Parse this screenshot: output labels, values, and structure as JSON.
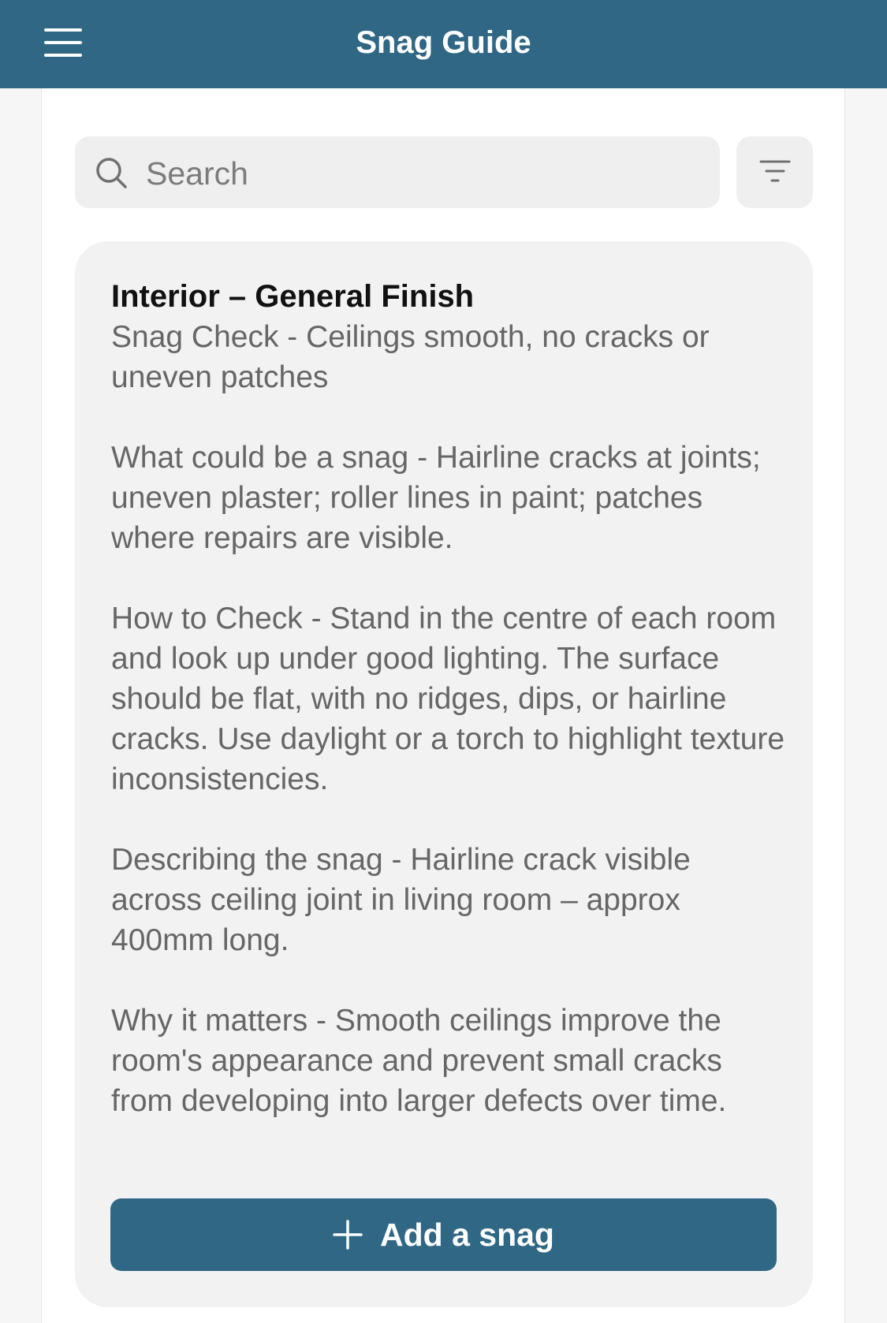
{
  "header": {
    "title": "Snag Guide",
    "menu_icon": "hamburger-menu-icon",
    "background": "#2f6784"
  },
  "search": {
    "placeholder": "Search",
    "value": "",
    "icon": "search-icon"
  },
  "filter": {
    "icon": "filter-icon"
  },
  "card": {
    "title": "Interior – General Finish",
    "snag_check": "Snag Check - Ceilings smooth, no cracks or uneven patches",
    "what_could_be": "What could be a snag - Hairline cracks at joints; uneven plaster; roller lines in paint; patches where repairs are visible.",
    "how_to_check": "How to Check - Stand in the centre of each room and look up under good lighting. The surface should be flat, with no ridges, dips, or hairline cracks. Use daylight or a torch to highlight texture inconsistencies.",
    "describing": "Describing the snag - Hairline crack visible across ceiling joint in living room – approx 400mm long.",
    "why_it_matters": "Why it matters - Smooth ceilings improve the room's appearance and prevent small cracks from developing into larger defects over time.",
    "add_button_label": "Add a snag",
    "add_button_icon": "plus-icon"
  },
  "colors": {
    "accent": "#2f6784",
    "card_bg": "#f2f2f3",
    "body_text": "#666666"
  }
}
